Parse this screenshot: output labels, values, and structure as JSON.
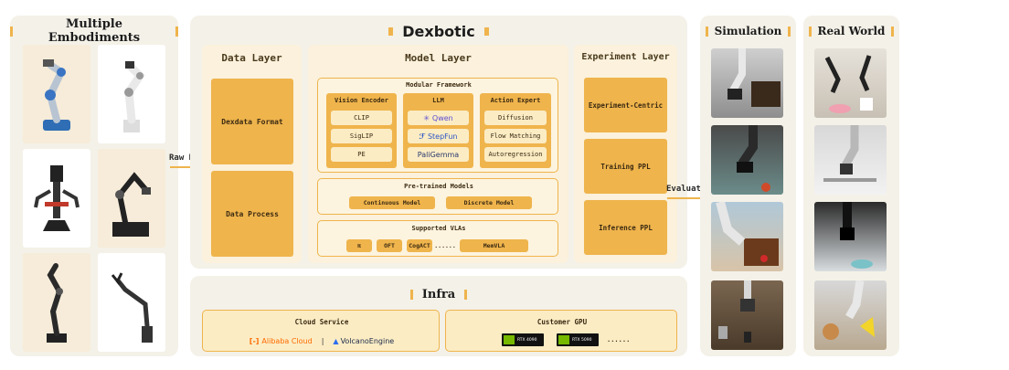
{
  "embodiments": {
    "title": "Multiple Embodiments"
  },
  "dexbotic": {
    "title": "Dexbotic"
  },
  "data_layer": {
    "title": "Data Layer",
    "items": [
      "Dexdata Format",
      "Data Process"
    ]
  },
  "model_layer": {
    "title": "Model Layer",
    "modular_framework": {
      "title": "Modular Framework",
      "vision_encoder": {
        "title": "Vision Encoder",
        "items": [
          "CLIP",
          "SigLIP",
          "PE"
        ]
      },
      "llm": {
        "title": "LLM",
        "items": [
          "Qwen",
          "StepFun",
          "PaliGemma"
        ]
      },
      "action_expert": {
        "title": "Action Expert",
        "items": [
          "Diffusion",
          "Flow Matching",
          "Autoregression"
        ]
      }
    },
    "pretrained": {
      "title": "Pre-trained Models",
      "items": [
        "Continuous Model",
        "Discrete Model"
      ]
    },
    "vlas": {
      "title": "Supported VLAs",
      "items": [
        "π",
        "OFT",
        "CogACT",
        "......",
        "MemVLA"
      ]
    }
  },
  "experiment_layer": {
    "title": "Experiment Layer",
    "items": [
      "Experiment-Centric",
      "Training PPL",
      "Inference PPL"
    ]
  },
  "arrows": {
    "raw_data": "Raw Data",
    "evaluate": "Evaluate"
  },
  "infra": {
    "title": "Infra",
    "cloud": {
      "title": "Cloud Service",
      "alibaba": "Alibaba Cloud",
      "sep": "|",
      "volcano": "VolcanoEngine"
    },
    "gpu": {
      "title": "Customer GPU",
      "cards": [
        "RTX 4090",
        "RTX 5090"
      ],
      "more": "......"
    }
  },
  "simulation": {
    "title": "Simulation"
  },
  "real_world": {
    "title": "Real World"
  },
  "colors": {
    "accent": "#efb44c",
    "panel": "#f4f1e8",
    "cream": "#fbecc4",
    "text": "#3b2a12"
  }
}
